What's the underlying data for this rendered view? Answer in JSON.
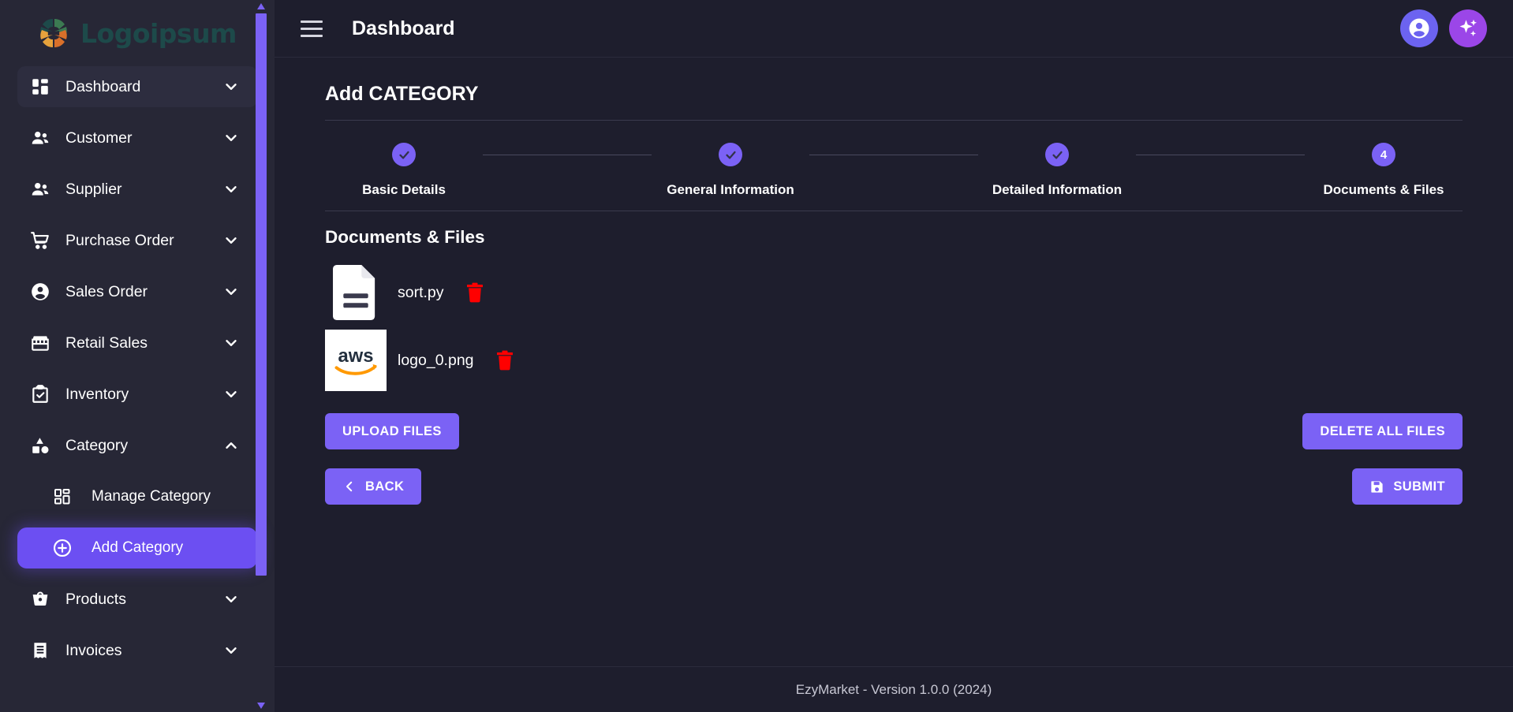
{
  "brand": {
    "logo_text": "Logoipsum",
    "logo_icon": "pinwheel-logo-icon",
    "colors": {
      "petal_teal": "#1d4a4a",
      "petal_green": "#3c7a52",
      "petal_light_orange": "#e6a23c",
      "petal_orange": "#d9702a",
      "logo_text": "#1d4a4a"
    }
  },
  "theme": {
    "sidebar_bg": "#272736",
    "main_bg": "#1e1e2d",
    "accent": "#7b62f5",
    "accent_highlight": "#6c4ff2",
    "avatar_btn": "#6c63f0",
    "ai_btn": "#9b46e8",
    "danger": "#ff0000",
    "divider": "#3a3a4d",
    "text": "#ffffff"
  },
  "sidebar": {
    "scrollbar": {
      "name": "sidebar-scrollbar",
      "thumb_color": "#7b62f5"
    },
    "items": [
      {
        "label": "Dashboard",
        "icon": "grid-dashboard-icon",
        "chevron": "chevron-down",
        "active": true,
        "sub": []
      },
      {
        "label": "Customer",
        "icon": "users-icon",
        "chevron": "chevron-down",
        "active": false,
        "sub": []
      },
      {
        "label": "Supplier",
        "icon": "users-icon",
        "chevron": "chevron-down",
        "active": false,
        "sub": []
      },
      {
        "label": "Purchase Order",
        "icon": "shopping-cart-icon",
        "chevron": "chevron-down",
        "active": false,
        "sub": []
      },
      {
        "label": "Sales Order",
        "icon": "user-circle-icon",
        "chevron": "chevron-down",
        "active": false,
        "sub": []
      },
      {
        "label": "Retail Sales",
        "icon": "storefront-icon",
        "chevron": "chevron-down",
        "active": false,
        "sub": []
      },
      {
        "label": "Inventory",
        "icon": "clipboard-check-icon",
        "chevron": "chevron-down",
        "active": false,
        "sub": []
      },
      {
        "label": "Category",
        "icon": "shapes-icon",
        "chevron": "chevron-up",
        "active": false,
        "sub": [
          {
            "label": "Manage Category",
            "icon": "grid-dashboard-icon",
            "selected": false
          },
          {
            "label": "Add Category",
            "icon": "plus-circle-icon",
            "selected": true
          }
        ]
      },
      {
        "label": "Products",
        "icon": "basket-icon",
        "chevron": "chevron-down",
        "active": false,
        "sub": []
      },
      {
        "label": "Invoices",
        "icon": "receipt-icon",
        "chevron": "chevron-down",
        "active": false,
        "sub": []
      }
    ]
  },
  "topbar": {
    "menu_icon": "hamburger-menu-icon",
    "title": "Dashboard",
    "avatar_icon": "user-avatar-icon",
    "ai_icon": "sparkles-icon"
  },
  "page": {
    "title": "Add CATEGORY",
    "stepper": [
      {
        "label": "Basic Details",
        "state": "completed",
        "badge": "check"
      },
      {
        "label": "General Information",
        "state": "completed",
        "badge": "check"
      },
      {
        "label": "Detailed Information",
        "state": "completed",
        "badge": "check"
      },
      {
        "label": "Documents & Files",
        "state": "current",
        "badge": "4"
      }
    ],
    "section_title": "Documents & Files",
    "files": [
      {
        "name": "sort.py",
        "thumb": "document-file-icon",
        "delete_icon": "trash-icon"
      },
      {
        "name": "logo_0.png",
        "thumb": "aws-logo-thumbnail",
        "delete_icon": "trash-icon"
      }
    ],
    "buttons": {
      "upload": "UPLOAD FILES",
      "delete_all": "DELETE ALL FILES",
      "back": "BACK",
      "back_icon": "chevron-left-icon",
      "submit": "SUBMIT",
      "submit_icon": "save-floppy-icon"
    }
  },
  "footer": {
    "text": "EzyMarket - Version 1.0.0 (2024)"
  }
}
